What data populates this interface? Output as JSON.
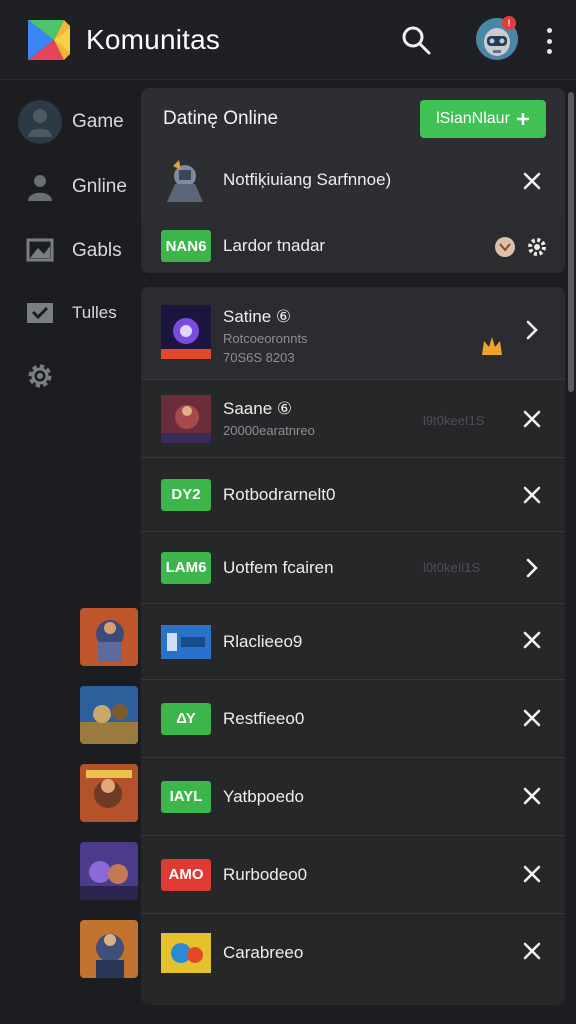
{
  "app": {
    "title": "Komunitas",
    "notification_count": "!"
  },
  "sidebar": {
    "items": [
      {
        "label": "Game",
        "icon": "user-icon"
      },
      {
        "label": "Gnline",
        "icon": "person-icon"
      },
      {
        "label": "Gabls",
        "icon": "image-icon"
      },
      {
        "label": "Tulles",
        "icon": "check-folder-icon"
      },
      {
        "label": "",
        "icon": "gear-icon"
      }
    ]
  },
  "top_card": {
    "title": "Datinę Online",
    "button_label": "lSianNlaur",
    "notification": "Notfiķiuiang Sarfnnoe)",
    "tag": "NAN6",
    "status_text": "Lardor tnadar"
  },
  "list": {
    "rows": [
      {
        "title": "Satine ⑥",
        "sub1": "Rotcoeoronnts",
        "sub2": "70S6S 8203",
        "tag": "",
        "ghost": "",
        "action": "chevron"
      },
      {
        "title": "Saane ⑥",
        "sub1": "20000earatnreo",
        "sub2": "",
        "tag": "",
        "ghost": "l9t0keeI1S",
        "action": "close"
      },
      {
        "title": "Rotbodrarnelt0",
        "sub1": "",
        "sub2": "",
        "tag": "DY2",
        "ghost": "",
        "action": "close"
      },
      {
        "title": "Uotfem fcairen",
        "sub1": "",
        "sub2": "",
        "tag": "LAM6",
        "ghost": "l0t0keIl1S",
        "action": "chevron"
      },
      {
        "title": "Rlaclieeo9",
        "sub1": "",
        "sub2": "",
        "tag": "",
        "ghost": "",
        "action": "close"
      },
      {
        "title": "Restfieeo0",
        "sub1": "",
        "sub2": "",
        "tag": "ΔΥ",
        "ghost": "",
        "action": "close"
      },
      {
        "title": "Yatbpoedo",
        "sub1": "",
        "sub2": "",
        "tag": "IAYL",
        "ghost": "",
        "action": "close"
      },
      {
        "title": "Rurbodeo0",
        "sub1": "",
        "sub2": "",
        "tag": "AMO",
        "ghost": "",
        "action": "close"
      },
      {
        "title": "Carabreeo",
        "sub1": "",
        "sub2": "",
        "tag": "",
        "ghost": "",
        "action": "close"
      }
    ]
  },
  "colors": {
    "accent_green": "#3fc154",
    "danger_red": "#e03a35",
    "background": "#1c1d20",
    "panel": "#2b2c30"
  }
}
